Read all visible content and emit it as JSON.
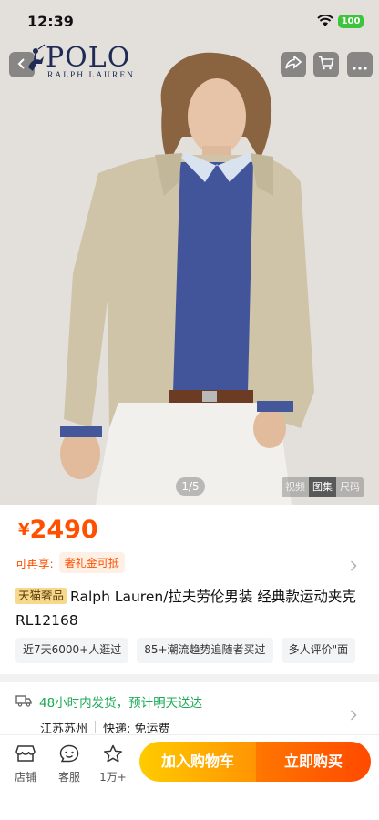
{
  "status_bar": {
    "time": "12:39",
    "battery": "100"
  },
  "brand": {
    "name": "POLO",
    "sub": "RALPH LAUREN"
  },
  "gallery": {
    "indicator": "1/5",
    "tabs": [
      "视频",
      "图集",
      "尺码"
    ],
    "active_tab": "图集"
  },
  "product": {
    "currency": "¥",
    "price": "2490",
    "perk_label": "可再享:",
    "perk_chip": "奢礼金可抵",
    "badge": "天猫奢品",
    "title": "Ralph Lauren/拉夫劳伦男装 经典款运动夹克 RL12168",
    "tags": [
      "近7天6000+人逛过",
      "85+潮流趋势追随者买过",
      "多人评价\"面"
    ]
  },
  "shipping": {
    "text": "48小时内发货，预计明天送达",
    "origin": "江苏苏州",
    "fee": "快递: 免运费"
  },
  "bottom_bar": {
    "store": "店铺",
    "service": "客服",
    "favorites": "1万+",
    "add_to_cart": "加入购物车",
    "buy_now": "立即购买"
  },
  "colors": {
    "accent": "#ff5000",
    "shipping": "#1aaa55",
    "cart_gradient": [
      "#ffcb00",
      "#ff9402"
    ],
    "buy_gradient": [
      "#ff7700",
      "#ff4900"
    ]
  }
}
